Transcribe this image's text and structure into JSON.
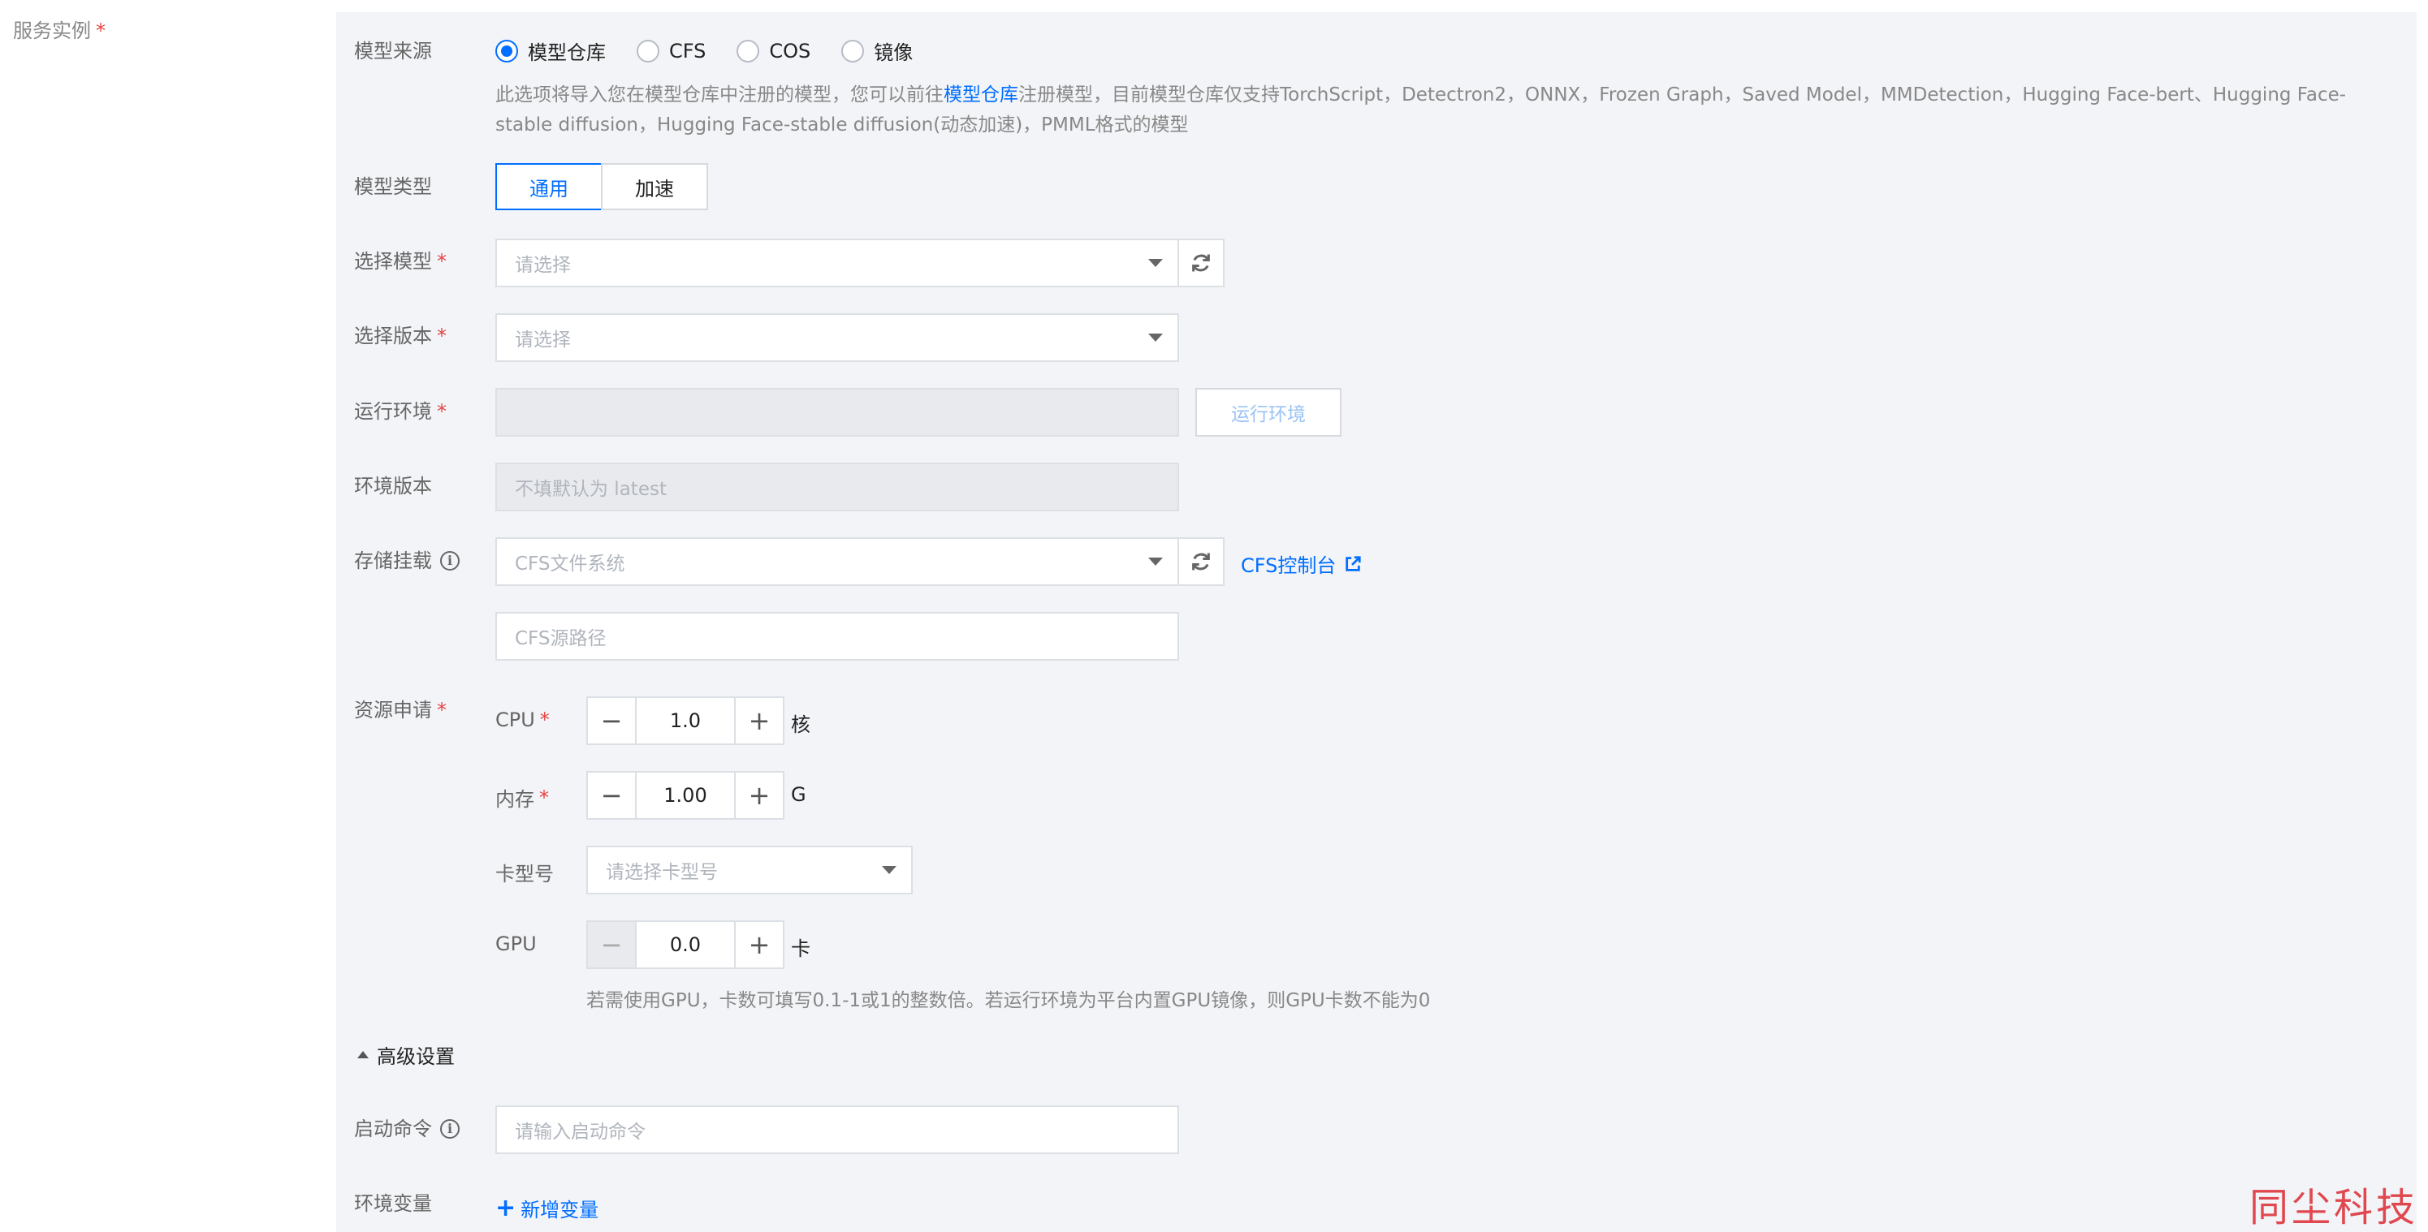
{
  "section": {
    "label": "服务实例",
    "required_mark": "*"
  },
  "model_source": {
    "label": "模型来源",
    "options": [
      {
        "label": "模型仓库",
        "checked": true
      },
      {
        "label": "CFS",
        "checked": false
      },
      {
        "label": "COS",
        "checked": false
      },
      {
        "label": "镜像",
        "checked": false
      }
    ],
    "desc_prefix": "此选项将导入您在模型仓库中注册的模型，您可以前往",
    "desc_link": "模型仓库",
    "desc_suffix": "注册模型，目前模型仓库仅支持TorchScript，Detectron2，ONNX，Frozen Graph，Saved Model，MMDetection，Hugging Face-bert、Hugging Face-stable diffusion，Hugging Face-stable diffusion(动态加速)，PMML格式的模型"
  },
  "model_type": {
    "label": "模型类型",
    "options": [
      "通用",
      "加速"
    ],
    "active": "通用"
  },
  "select_model": {
    "label": "选择模型",
    "placeholder": "请选择"
  },
  "select_version": {
    "label": "选择版本",
    "placeholder": "请选择"
  },
  "runtime_env": {
    "label": "运行环境",
    "button": "运行环境"
  },
  "env_version": {
    "label": "环境版本",
    "placeholder": "不填默认为 latest"
  },
  "storage": {
    "label": "存储挂载",
    "select_placeholder": "CFS文件系统",
    "console_link": "CFS控制台",
    "path_placeholder": "CFS源路径"
  },
  "resources": {
    "label": "资源申请",
    "cpu": {
      "label": "CPU",
      "value": "1.0",
      "unit": "核"
    },
    "memory": {
      "label": "内存",
      "value": "1.00",
      "unit": "G"
    },
    "card_type": {
      "label": "卡型号",
      "placeholder": "请选择卡型号"
    },
    "gpu": {
      "label": "GPU",
      "value": "0.0",
      "unit": "卡"
    },
    "gpu_hint": "若需使用GPU，卡数可填写0.1-1或1的整数倍。若运行环境为平台内置GPU镜像，则GPU卡数不能为0"
  },
  "advanced": {
    "label": "高级设置"
  },
  "start_command": {
    "label": "启动命令",
    "placeholder": "请输入启动命令"
  },
  "env_vars": {
    "label": "环境变量",
    "add_label": "新增变量"
  },
  "watermark": "同尘科技",
  "colors": {
    "accent": "#006eff",
    "required": "#e54545",
    "panel_bg": "#f3f4f7"
  }
}
